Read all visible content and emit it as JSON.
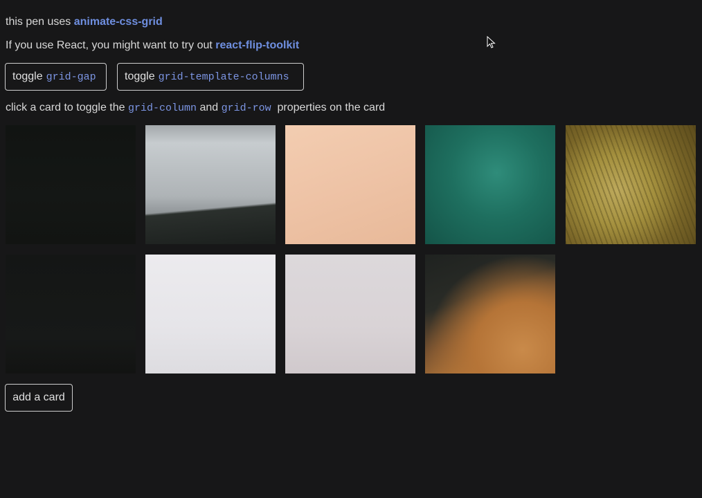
{
  "intro": {
    "prefix": "this pen uses ",
    "link": "animate-css-grid"
  },
  "react_note": {
    "prefix": "If you use React, you might want to try out ",
    "link": "react-flip-toolkit"
  },
  "buttons": {
    "toggle_gap": {
      "word": "toggle",
      "code": "grid-gap"
    },
    "toggle_columns": {
      "word": "toggle",
      "code": "grid-template-columns"
    },
    "add_card": "add a card"
  },
  "instructions": {
    "part1": "click a card to toggle the ",
    "code1": "grid-column",
    "part2": " and ",
    "code2": "grid-row",
    "part3": "  properties on the card"
  },
  "colors": {
    "background": "#171718",
    "link": "#6f8fe0",
    "code": "#7c95e3",
    "text": "#d9d9d9"
  },
  "cards": [
    {
      "name": "dark-forest"
    },
    {
      "name": "mountain-sky"
    },
    {
      "name": "peach-skin"
    },
    {
      "name": "ocean-water"
    },
    {
      "name": "dry-grass"
    },
    {
      "name": "dark-texture"
    },
    {
      "name": "white-fabric"
    },
    {
      "name": "pale-pink"
    },
    {
      "name": "blurred-portrait"
    }
  ]
}
